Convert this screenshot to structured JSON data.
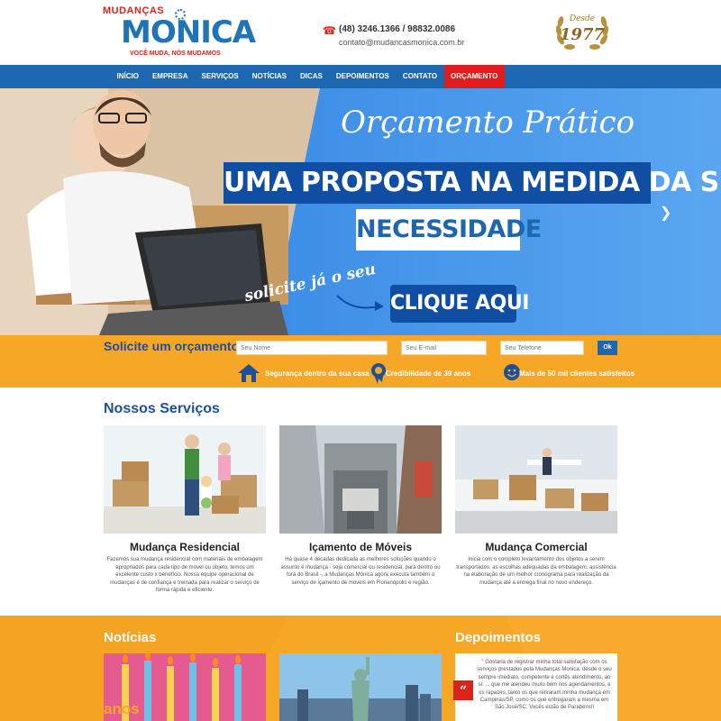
{
  "header": {
    "logo_top": "MUDANÇAS",
    "logo_main": "MONICA",
    "logo_tagline": "VOCÊ MUDA, NÓS MUDAMOS",
    "phone": "(48) 3246.1366 / 98832.0086",
    "email": "contato@mudancasmonica.com.br",
    "badge_desde": "Desde",
    "badge_year": "1977"
  },
  "nav": {
    "items": [
      "INÍCIO",
      "EMPRESA",
      "SERVIÇOS",
      "NOTÍCIAS",
      "DICAS",
      "DEPOIMENTOS",
      "CONTATO",
      "ORÇAMENTO"
    ]
  },
  "hero": {
    "title": "Orçamento Prático",
    "line1": "UMA PROPOSTA NA MEDIDA DA SUA",
    "line2": "NECESSIDADE",
    "solicite": "solicite já o seu",
    "cta": "CLIQUE AQUI"
  },
  "quote": {
    "title": "Solicite um orçamento",
    "name_placeholder": "Seu Nome",
    "email_placeholder": "Seu E-mail",
    "phone_placeholder": "Seu Telefone",
    "submit": "Ok",
    "features": [
      "Segurança dentro da sua casa",
      "Credibilidade de 39 anos",
      "Mais de 50 mil clientes satisfeitos"
    ]
  },
  "services": {
    "title": "Nossos Serviços",
    "items": [
      {
        "title": "Mudança Residencial",
        "desc": "Fazemos sua mudança residencial com materiais de embalagem apropriados para cada tipo de móvel ou objeto, temos um excelente custo x benefício. Nossa equipe operacional de mudanças é de confiança e treinada para realizar o serviço de forma rápida e eficiente."
      },
      {
        "title": "Içamento de Móveis",
        "desc": "Há quase 4 décadas dedicada as melhores soluções quando o assunto é mudança - seja comercial ou residencial, para dentro ou fora do Brasil -, a Mudanças Mônica agora executa também o serviço de içamento de móveis em Florianópolis e região."
      },
      {
        "title": "Mudança Comercial",
        "desc": "Inicia com o completo levantamento dos objetos a serem transportados, as escolhas adequadas da embalagem, assistência na elaboração de um melhor cronograma para realização da mudança até a entrega final no novo endereço."
      }
    ]
  },
  "news": {
    "title": "Notícias",
    "item1_text": "anos"
  },
  "testimonials": {
    "title": "Depoimentos",
    "quote_mark": "“",
    "text": "\" Gostaria de registrar minha total satisfação com os serviços prestados pela Mudanças Monica, desde o seu sempre imediato, competente e cortês atendimento, ao sr. ... que me atendeu muito bem nos agendamentos, e os rapazes, tanto os que retiraram minha mudança em Campinas/SP, como os que entregaram a mesma em São José/SC. Vocês estão de Parabéns!!"
  },
  "colors": {
    "brand_blue": "#1d66b0",
    "brand_red": "#e21b1b",
    "orange": "#f6a726",
    "dark_blue": "#0f4ea3"
  }
}
